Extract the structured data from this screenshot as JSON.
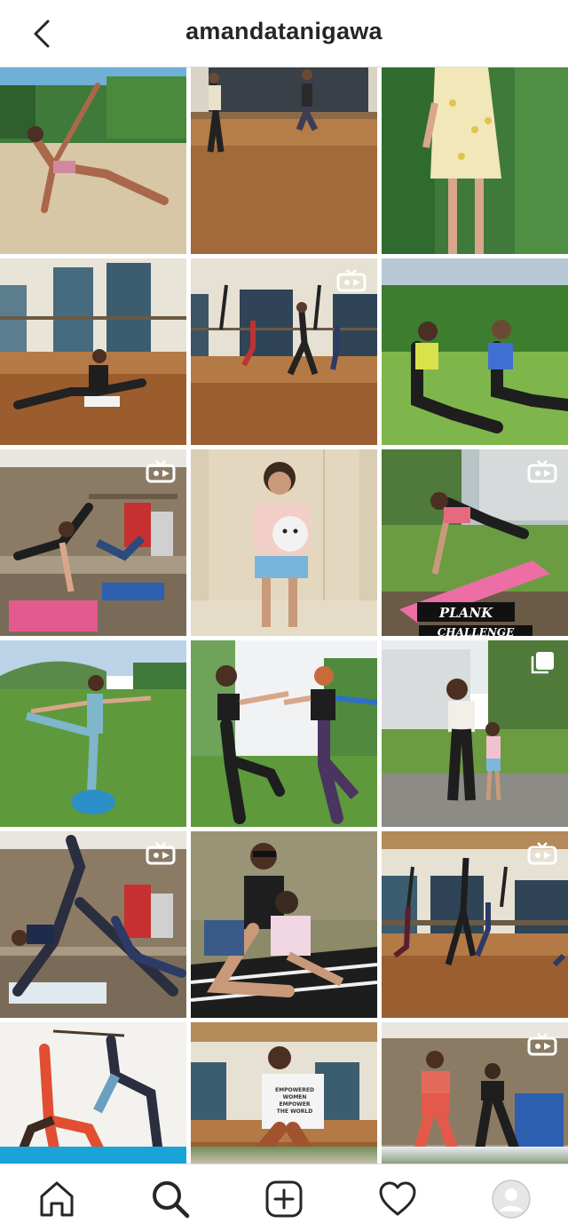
{
  "header": {
    "title": "amandatanigawa",
    "back_icon": "chevron-left-icon"
  },
  "grid": {
    "posts": [
      {
        "type": "image",
        "scene": "beach-side-plank"
      },
      {
        "type": "image",
        "scene": "studio-dancers"
      },
      {
        "type": "image",
        "scene": "girl-floral-dress"
      },
      {
        "type": "image",
        "scene": "studio-floor-stretch"
      },
      {
        "type": "igtv",
        "scene": "studio-dance-class"
      },
      {
        "type": "image",
        "scene": "two-women-stretch-grass"
      },
      {
        "type": "igtv",
        "scene": "garage-workout"
      },
      {
        "type": "image",
        "scene": "girl-holding-plush"
      },
      {
        "type": "igtv",
        "scene": "plank-challenge",
        "caption_lines": [
          "PLANK",
          "CHALLENGE"
        ]
      },
      {
        "type": "image",
        "scene": "balance-pose-grass"
      },
      {
        "type": "image",
        "scene": "two-women-kick"
      },
      {
        "type": "carousel",
        "scene": "mother-daughter-yard"
      },
      {
        "type": "igtv",
        "scene": "garage-side-plank"
      },
      {
        "type": "image",
        "scene": "mother-daughter-blanket"
      },
      {
        "type": "igtv",
        "scene": "studio-dance-class-2"
      },
      {
        "type": "image",
        "scene": "partner-yoga"
      },
      {
        "type": "image",
        "scene": "empowered-women-tee",
        "shirt_text": [
          "EMPOWERED",
          "WOMEN",
          "EMPOWER",
          "THE WORLD"
        ]
      },
      {
        "type": "igtv",
        "scene": "garage-two-women"
      }
    ]
  },
  "bottom_nav": {
    "items": [
      {
        "icon": "home-icon",
        "label": "Home"
      },
      {
        "icon": "search-icon",
        "label": "Search"
      },
      {
        "icon": "new-post-icon",
        "label": "New Post"
      },
      {
        "icon": "heart-icon",
        "label": "Activity"
      },
      {
        "icon": "profile-avatar-icon",
        "label": "Profile"
      }
    ]
  },
  "colors": {
    "border": "#dbdbdb",
    "text": "#262626",
    "badge": "#ffffff"
  }
}
